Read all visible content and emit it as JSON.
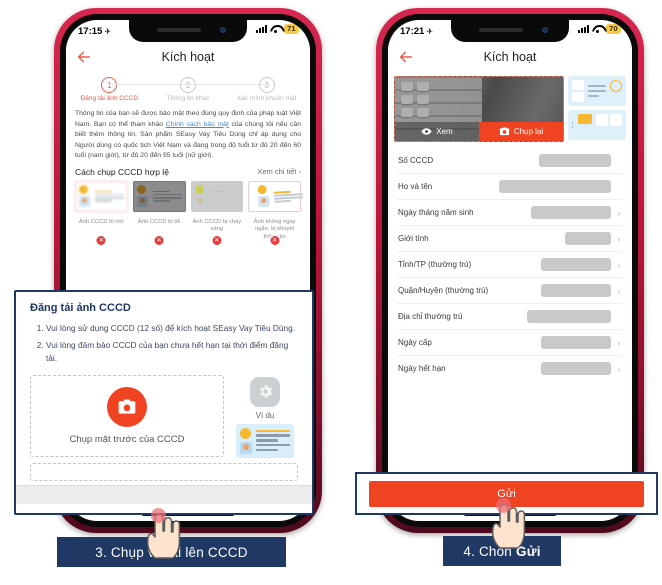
{
  "phone1": {
    "status": {
      "time": "17:15",
      "airplane_icon": "airplane-icon",
      "signal_icon": "signal-bars-icon",
      "wifi_icon": "wifi-icon",
      "battery": "71"
    },
    "header": {
      "back_icon": "back-arrow-icon",
      "title": "Kích hoạt"
    },
    "steps": [
      {
        "num": "1",
        "label": "Đăng tải ảnh CCCD",
        "active": true
      },
      {
        "num": "2",
        "label": "Thông tin khác",
        "active": false
      },
      {
        "num": "3",
        "label": "Xác minh khuôn mặt",
        "active": false
      }
    ],
    "legal": {
      "part1": "Thông tin của bạn sẽ được bảo mật theo đúng quy định của pháp luật Việt Nam. Bạn có thể tham khảo ",
      "link": "Chính sách bảo mật",
      "part2": " của chúng tôi nếu cần biết thêm thông tin. Sản phẩm SEasy Vay Tiêu Dùng chỉ áp dụng cho Người dùng có quốc tịch Việt Nam và đang trong độ tuổi từ đủ 20 đến 60 tuổi (nam giới), từ đủ 20 đến 55 tuổi (nữ giới)."
    },
    "howto": {
      "title": "Cách chụp CCCD hợp lệ",
      "more": "Xem chi tiết",
      "more_icon": "chevron-right-icon",
      "cards": [
        {
          "caption": "Ảnh CCCD bị mờ",
          "badge": "✕"
        },
        {
          "caption": "Ảnh CCCD bị tối",
          "badge": "✕"
        },
        {
          "caption": "Ảnh CCCD bị cháy sáng",
          "badge": "✕"
        },
        {
          "caption": "Ảnh không ngay ngắn, bị khuyết thông tin",
          "badge": "✕"
        }
      ]
    },
    "overlay": {
      "title": "Đăng tải ảnh CCCD",
      "items": [
        "Vui lòng sử dụng CCCD (12 số) để kích hoạt SEasy Vay Tiêu Dùng.",
        "Vui lòng đảm bảo CCCD của bạn chưa hết hạn tại thời điểm đăng tải."
      ],
      "camera_icon": "camera-icon",
      "capture_label": "Chụp mặt trước của CCCD",
      "gear_icon": "gear-icon",
      "example_label": "Ví dụ"
    },
    "caption": {
      "text": "3. Chụp và tải lên CCCD"
    }
  },
  "phone2": {
    "status": {
      "time": "17:21",
      "airplane_icon": "airplane-icon",
      "signal_icon": "signal-bars-icon",
      "wifi_icon": "wifi-icon",
      "battery": "70"
    },
    "header": {
      "back_icon": "back-arrow-icon",
      "title": "Kích hoạt"
    },
    "preview": {
      "view_label": "Xem",
      "view_icon": "eye-icon",
      "retake_label": "Chụp lại",
      "retake_icon": "camera-icon"
    },
    "form": [
      {
        "label": "Số CCCD",
        "value_width": 72,
        "chevron": false
      },
      {
        "label": "Họ và tên",
        "value_width": 112,
        "chevron": false
      },
      {
        "label": "Ngày tháng năm sinh",
        "value_width": 80,
        "chevron": true
      },
      {
        "label": "Giới tính",
        "value_width": 46,
        "chevron": true
      },
      {
        "label": "Tỉnh/TP (thường trú)",
        "value_width": 70,
        "chevron": true
      },
      {
        "label": "Quận/Huyện (thường trú)",
        "value_width": 70,
        "chevron": true
      },
      {
        "label": "Địa chỉ thường trú",
        "value_width": 84,
        "chevron": false
      },
      {
        "label": "Ngày cấp",
        "value_width": 70,
        "chevron": true
      },
      {
        "label": "Ngày hết hạn",
        "value_width": 70,
        "chevron": true
      }
    ],
    "submit": {
      "label": "Gửi"
    },
    "caption": {
      "prefix": "4. Chon",
      "bold": "Gửi"
    }
  },
  "colors": {
    "brand_red": "#f04322",
    "accent_pink": "#ef5a4c",
    "navy": "#1f3864",
    "link_blue": "#3f8bdc",
    "battery_yellow": "#f7c948"
  }
}
